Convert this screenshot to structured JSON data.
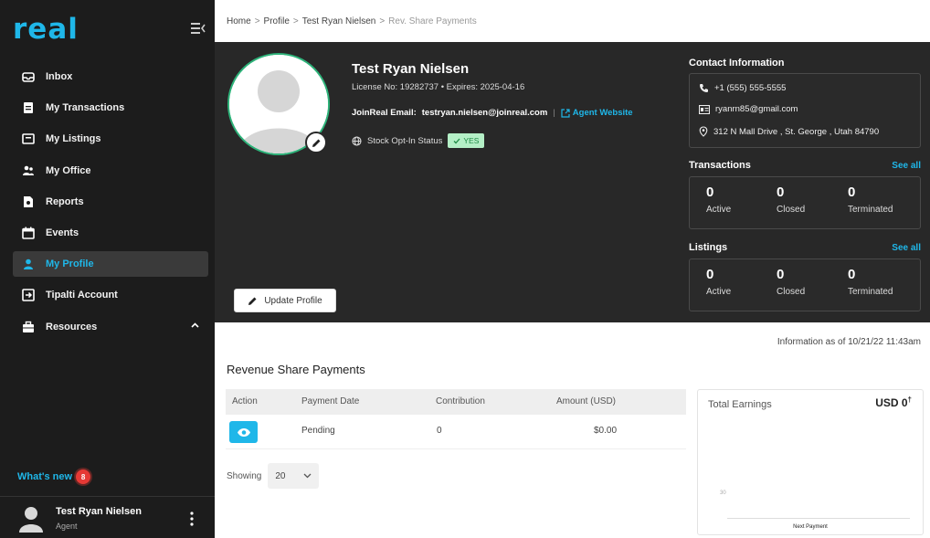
{
  "app": {
    "logo_text": "real",
    "brand_color": "#1fb7e9"
  },
  "sidebar": {
    "items": [
      {
        "label": "Inbox",
        "icon": "inbox-icon"
      },
      {
        "label": "My Transactions",
        "icon": "clipboard-icon"
      },
      {
        "label": "My Listings",
        "icon": "listing-icon"
      },
      {
        "label": "My Office",
        "icon": "people-icon"
      },
      {
        "label": "Reports",
        "icon": "report-icon"
      },
      {
        "label": "Events",
        "icon": "calendar-icon"
      },
      {
        "label": "My Profile",
        "icon": "person-icon",
        "active": true
      },
      {
        "label": "Tipalti Account",
        "icon": "account-icon"
      },
      {
        "label": "Resources",
        "icon": "briefcase-icon"
      }
    ],
    "whats_new": {
      "label": "What's new",
      "count": "8"
    },
    "user": {
      "name": "Test Ryan Nielsen",
      "role": "Agent"
    }
  },
  "breadcrumb": [
    "Home",
    "Profile",
    "Test Ryan Nielsen",
    "Rev. Share Payments"
  ],
  "profile": {
    "name": "Test Ryan Nielsen",
    "license_line": "License No: 19282737  •  Expires: 2025-04-16",
    "email_label": "JoinReal Email:",
    "email": "testryan.nielsen@joinreal.com",
    "website_label": "Agent Website",
    "stock_label": "Stock Opt-In Status",
    "stock_value": "YES",
    "update_button": "Update Profile"
  },
  "contact": {
    "title": "Contact Information",
    "phone": "+1 (555) 555-5555",
    "email": "ryanrn85@gmail.com",
    "address": "312 N Mall Drive , St. George , Utah 84790"
  },
  "transactions": {
    "title": "Transactions",
    "see_all": "See all",
    "stats": [
      {
        "value": "0",
        "label": "Active"
      },
      {
        "value": "0",
        "label": "Closed"
      },
      {
        "value": "0",
        "label": "Terminated"
      }
    ]
  },
  "listings": {
    "title": "Listings",
    "see_all": "See all",
    "stats": [
      {
        "value": "0",
        "label": "Active"
      },
      {
        "value": "0",
        "label": "Closed"
      },
      {
        "value": "0",
        "label": "Terminated"
      }
    ]
  },
  "info_as_of": "Information as of 10/21/22 11:43am",
  "revenue": {
    "title": "Revenue Share Payments",
    "columns": [
      "Action",
      "Payment Date",
      "Contribution",
      "Amount (USD)"
    ],
    "rows": [
      {
        "payment_date": "Pending",
        "contribution": "0",
        "amount": "$0.00"
      }
    ],
    "showing_label": "Showing",
    "page_size": "20"
  },
  "earnings": {
    "title": "Total Earnings",
    "value": "USD 0",
    "marker": "†",
    "tick": "30",
    "x_label": "Next Payment"
  }
}
